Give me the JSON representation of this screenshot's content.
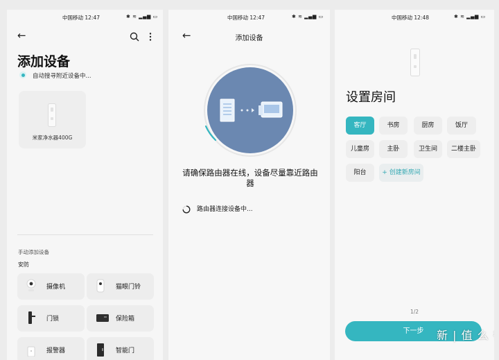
{
  "screen1": {
    "status_time": "中国移动 12:47",
    "status_icons": "✱ ≋ ▂▄▆ ▭",
    "title": "添加设备",
    "searching_text": "自动搜寻附近设备中...",
    "found_device": "米家净水器400G",
    "manual_header": "手动添加设备",
    "category": "安防",
    "devices": [
      {
        "label": "摄像机",
        "icon": "camera-icon"
      },
      {
        "label": "猫眼门铃",
        "icon": "doorbell-icon"
      },
      {
        "label": "门锁",
        "icon": "door-lock-icon"
      },
      {
        "label": "保险箱",
        "icon": "safe-icon"
      },
      {
        "label": "报警器",
        "icon": "alarm-icon"
      },
      {
        "label": "智能门",
        "icon": "smart-door-icon"
      }
    ]
  },
  "screen2": {
    "status_time": "中国移动 12:47",
    "status_icons": "✱ ≋ ▂▄▆ ▭",
    "title": "添加设备",
    "message": "请确保路由器在线，设备尽量靠近路由器",
    "progress_text": "路由器连接设备中..."
  },
  "screen3": {
    "status_time": "中国移动 12:48",
    "status_icons": "✱ ≋ ▂▄▆ ▭",
    "title": "设置房间",
    "rooms": [
      "客厅",
      "书房",
      "厨房",
      "饭厅",
      "儿童房",
      "主卧",
      "卫生间",
      "二楼主卧",
      "阳台"
    ],
    "create_room": "+ 创建新房间",
    "page_indicator": "1/2",
    "next_button": "下一步"
  },
  "watermark": "新 | 值 么 得 买",
  "colors": {
    "accent": "#35b6c0",
    "circle": "#6b88b1"
  }
}
